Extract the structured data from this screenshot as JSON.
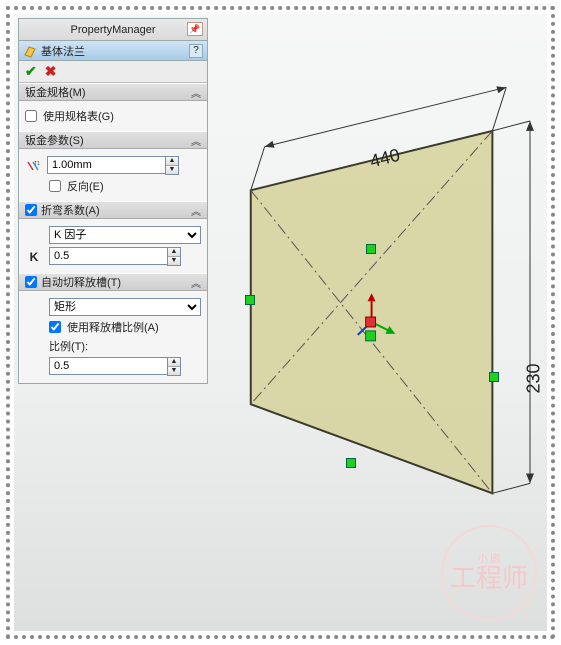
{
  "header": {
    "title": "PropertyManager"
  },
  "feature": {
    "name": "基体法兰"
  },
  "sections": {
    "gauge": {
      "title": "钣金规格(M)",
      "use_gauge_table": {
        "label": "使用规格表(G)",
        "checked": false
      }
    },
    "params": {
      "title": "钣金参数(S)",
      "thickness": "1.00mm",
      "reverse": {
        "label": "反向(E)",
        "checked": false
      }
    },
    "bend": {
      "title": "折弯系数(A)",
      "checked": true,
      "method_options": [
        "K 因子"
      ],
      "method": "K 因子",
      "k_label": "K",
      "k_value": "0.5"
    },
    "relief": {
      "title": "自动切释放槽(T)",
      "checked": true,
      "type_options": [
        "矩形"
      ],
      "type": "矩形",
      "use_ratio": {
        "label": "使用释放槽比例(A)",
        "checked": true
      },
      "ratio_label": "比例(T):",
      "ratio_value": "0.5"
    }
  },
  "sketch": {
    "dim_top": "440",
    "dim_right": "230"
  },
  "watermark": {
    "small": "小 國",
    "big": "工程师"
  }
}
